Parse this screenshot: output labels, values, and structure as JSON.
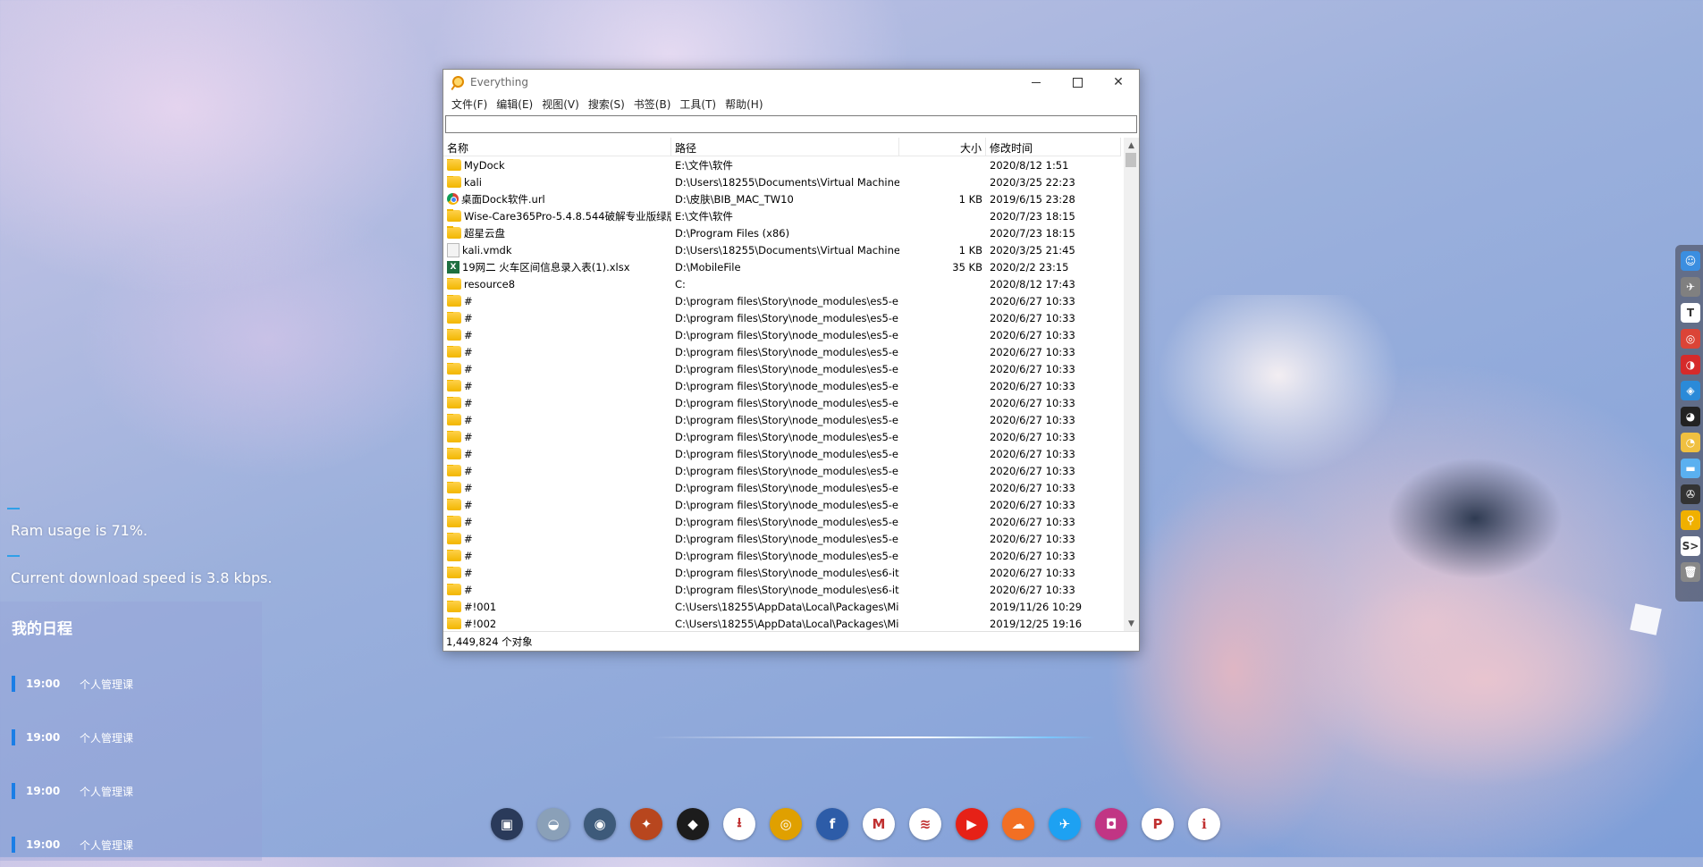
{
  "window": {
    "title": "Everything",
    "menu": [
      "文件(F)",
      "编辑(E)",
      "视图(V)",
      "搜索(S)",
      "书签(B)",
      "工具(T)",
      "帮助(H)"
    ],
    "search_value": "",
    "columns": {
      "name": "名称",
      "path": "路径",
      "size": "大小",
      "date": "修改时间"
    },
    "rows": [
      {
        "icon": "folder",
        "name": "MyDock",
        "path": "E:\\文件\\软件",
        "size": "",
        "date": "2020/8/12 1:51"
      },
      {
        "icon": "folder",
        "name": "kali",
        "path": "D:\\Users\\18255\\Documents\\Virtual Machines",
        "size": "",
        "date": "2020/3/25 22:23"
      },
      {
        "icon": "url",
        "name": "桌面Dock软件.url",
        "path": "D:\\皮肤\\BIB_MAC_TW10",
        "size": "1 KB",
        "date": "2019/6/15 23:28"
      },
      {
        "icon": "folder",
        "name": "Wise-Care365Pro-5.4.8.544破解专业版绿版",
        "path": "E:\\文件\\软件",
        "size": "",
        "date": "2020/7/23 18:15"
      },
      {
        "icon": "folder",
        "name": "超星云盘",
        "path": "D:\\Program Files (x86)",
        "size": "",
        "date": "2020/7/23 18:15"
      },
      {
        "icon": "vmdk",
        "name": "kali.vmdk",
        "path": "D:\\Users\\18255\\Documents\\Virtual Machines...",
        "size": "1 KB",
        "date": "2020/3/25 21:45"
      },
      {
        "icon": "xlsx",
        "name": "19网二 火车区间信息录入表(1).xlsx",
        "path": "D:\\MobileFile",
        "size": "35 KB",
        "date": "2020/2/2 23:15"
      },
      {
        "icon": "folder",
        "name": "resource8",
        "path": "C:",
        "size": "",
        "date": "2020/8/12 17:43"
      },
      {
        "icon": "folder",
        "name": "#",
        "path": "D:\\program files\\Story\\node_modules\\es5-e...",
        "size": "",
        "date": "2020/6/27 10:33"
      },
      {
        "icon": "folder",
        "name": "#",
        "path": "D:\\program files\\Story\\node_modules\\es5-e...",
        "size": "",
        "date": "2020/6/27 10:33"
      },
      {
        "icon": "folder",
        "name": "#",
        "path": "D:\\program files\\Story\\node_modules\\es5-e...",
        "size": "",
        "date": "2020/6/27 10:33"
      },
      {
        "icon": "folder",
        "name": "#",
        "path": "D:\\program files\\Story\\node_modules\\es5-e...",
        "size": "",
        "date": "2020/6/27 10:33"
      },
      {
        "icon": "folder",
        "name": "#",
        "path": "D:\\program files\\Story\\node_modules\\es5-e...",
        "size": "",
        "date": "2020/6/27 10:33"
      },
      {
        "icon": "folder",
        "name": "#",
        "path": "D:\\program files\\Story\\node_modules\\es5-e...",
        "size": "",
        "date": "2020/6/27 10:33"
      },
      {
        "icon": "folder",
        "name": "#",
        "path": "D:\\program files\\Story\\node_modules\\es5-e...",
        "size": "",
        "date": "2020/6/27 10:33"
      },
      {
        "icon": "folder",
        "name": "#",
        "path": "D:\\program files\\Story\\node_modules\\es5-e...",
        "size": "",
        "date": "2020/6/27 10:33"
      },
      {
        "icon": "folder",
        "name": "#",
        "path": "D:\\program files\\Story\\node_modules\\es5-e...",
        "size": "",
        "date": "2020/6/27 10:33"
      },
      {
        "icon": "folder",
        "name": "#",
        "path": "D:\\program files\\Story\\node_modules\\es5-e...",
        "size": "",
        "date": "2020/6/27 10:33"
      },
      {
        "icon": "folder",
        "name": "#",
        "path": "D:\\program files\\Story\\node_modules\\es5-e...",
        "size": "",
        "date": "2020/6/27 10:33"
      },
      {
        "icon": "folder",
        "name": "#",
        "path": "D:\\program files\\Story\\node_modules\\es5-e...",
        "size": "",
        "date": "2020/6/27 10:33"
      },
      {
        "icon": "folder",
        "name": "#",
        "path": "D:\\program files\\Story\\node_modules\\es5-e...",
        "size": "",
        "date": "2020/6/27 10:33"
      },
      {
        "icon": "folder",
        "name": "#",
        "path": "D:\\program files\\Story\\node_modules\\es5-e...",
        "size": "",
        "date": "2020/6/27 10:33"
      },
      {
        "icon": "folder",
        "name": "#",
        "path": "D:\\program files\\Story\\node_modules\\es5-e...",
        "size": "",
        "date": "2020/6/27 10:33"
      },
      {
        "icon": "folder",
        "name": "#",
        "path": "D:\\program files\\Story\\node_modules\\es5-e...",
        "size": "",
        "date": "2020/6/27 10:33"
      },
      {
        "icon": "folder",
        "name": "#",
        "path": "D:\\program files\\Story\\node_modules\\es6-it...",
        "size": "",
        "date": "2020/6/27 10:33"
      },
      {
        "icon": "folder",
        "name": "#",
        "path": "D:\\program files\\Story\\node_modules\\es6-it...",
        "size": "",
        "date": "2020/6/27 10:33"
      },
      {
        "icon": "folder",
        "name": "#!001",
        "path": "C:\\Users\\18255\\AppData\\Local\\Packages\\Mi...",
        "size": "",
        "date": "2019/11/26 10:29"
      },
      {
        "icon": "folder",
        "name": "#!002",
        "path": "C:\\Users\\18255\\AppData\\Local\\Packages\\Mi...",
        "size": "",
        "date": "2019/12/25 19:16"
      }
    ],
    "status": "1,449,824 个对象"
  },
  "widgets": {
    "ram": "Ram usage is 71%.",
    "download": "Current download speed is 3.8 kbps."
  },
  "schedule": {
    "title": "我的日程",
    "days": [
      {
        "time": "19:00",
        "event": "个人管理课"
      },
      {
        "time": "19:00",
        "event": "个人管理课"
      },
      {
        "time": "19:00",
        "event": "个人管理课"
      },
      {
        "time": "19:00",
        "event": "个人管理课"
      }
    ]
  },
  "dock": [
    {
      "name": "computer",
      "glyph": "▣",
      "color": "#2a3a5a"
    },
    {
      "name": "landscape",
      "glyph": "◒",
      "color": "#8aa0b8"
    },
    {
      "name": "robot",
      "glyph": "◉",
      "color": "#3d5a7a"
    },
    {
      "name": "game",
      "glyph": "✦",
      "color": "#b8461e"
    },
    {
      "name": "darth",
      "glyph": "◆",
      "color": "#1c1c1c"
    },
    {
      "name": "download",
      "glyph": "⭳",
      "color": "#ffffff"
    },
    {
      "name": "chrome",
      "glyph": "◎",
      "color": "#e0a000"
    },
    {
      "name": "facebook",
      "glyph": "f",
      "color": "#2d5ca8"
    },
    {
      "name": "gmail",
      "glyph": "M",
      "color": "#ffffff"
    },
    {
      "name": "ublast",
      "glyph": "≋",
      "color": "#ffffff"
    },
    {
      "name": "youtube",
      "glyph": "▶",
      "color": "#e62117"
    },
    {
      "name": "soundcloud",
      "glyph": "☁",
      "color": "#f26f23"
    },
    {
      "name": "twitter",
      "glyph": "✈",
      "color": "#1da1f2"
    },
    {
      "name": "instagram",
      "glyph": "◘",
      "color": "#c13584"
    },
    {
      "name": "pinterest",
      "glyph": "P",
      "color": "#ffffff"
    },
    {
      "name": "info",
      "glyph": "ℹ",
      "color": "#ffffff"
    }
  ],
  "rdock": [
    {
      "name": "finder",
      "glyph": "☺",
      "color": "#3b8ee0"
    },
    {
      "name": "launchpad",
      "glyph": "✈",
      "color": "#808080"
    },
    {
      "name": "typora",
      "glyph": "T",
      "color": "#ffffff"
    },
    {
      "name": "chrome",
      "glyph": "◎",
      "color": "#db4437"
    },
    {
      "name": "netease",
      "glyph": "◑",
      "color": "#d62a2a"
    },
    {
      "name": "shield",
      "glyph": "◈",
      "color": "#2b8ad8"
    },
    {
      "name": "qq",
      "glyph": "◕",
      "color": "#222222"
    },
    {
      "name": "wechat",
      "glyph": "◔",
      "color": "#f0c040"
    },
    {
      "name": "folder",
      "glyph": "▬",
      "color": "#5ab0f0"
    },
    {
      "name": "aperture",
      "glyph": "✇",
      "color": "#333333"
    },
    {
      "name": "everything",
      "glyph": "⚲",
      "color": "#f0b000"
    },
    {
      "name": "terminal",
      "glyph": "S>",
      "color": "#ffffff"
    },
    {
      "name": "trash",
      "glyph": "🗑",
      "color": "#888888"
    }
  ]
}
